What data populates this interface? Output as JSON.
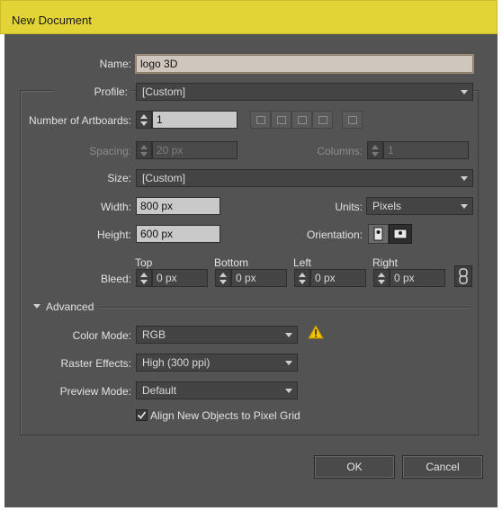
{
  "window": {
    "title": "New Document"
  },
  "name": {
    "label": "Name:",
    "value": "logo 3D"
  },
  "profile": {
    "label": "Profile:",
    "value": "[Custom]"
  },
  "artboards": {
    "label": "Number of Artboards:",
    "value": "1"
  },
  "spacing": {
    "label": "Spacing:",
    "value": "20 px"
  },
  "columns": {
    "label": "Columns:",
    "value": "1"
  },
  "size": {
    "label": "Size:",
    "value": "[Custom]"
  },
  "width": {
    "label": "Width:",
    "value": "800 px"
  },
  "units": {
    "label": "Units:",
    "value": "Pixels"
  },
  "height": {
    "label": "Height:",
    "value": "600 px"
  },
  "orientation": {
    "label": "Orientation:",
    "selected": "landscape"
  },
  "bleed": {
    "label": "Bleed:",
    "top": {
      "label": "Top",
      "value": "0 px"
    },
    "bottom": {
      "label": "Bottom",
      "value": "0 px"
    },
    "left": {
      "label": "Left",
      "value": "0 px"
    },
    "right": {
      "label": "Right",
      "value": "0 px"
    }
  },
  "advanced": {
    "label": "Advanced"
  },
  "color_mode": {
    "label": "Color Mode:",
    "value": "RGB",
    "warning_color": "#f2c200"
  },
  "raster_effects": {
    "label": "Raster Effects:",
    "value": "High (300 ppi)"
  },
  "preview_mode": {
    "label": "Preview Mode:",
    "value": "Default"
  },
  "align_pixel_grid": {
    "label": "Align New Objects to Pixel Grid",
    "checked": true
  },
  "buttons": {
    "ok": "OK",
    "cancel": "Cancel"
  },
  "colors": {
    "titlebar": "#e2d437",
    "dialog": "#535353",
    "field": "#c9c9c9"
  }
}
